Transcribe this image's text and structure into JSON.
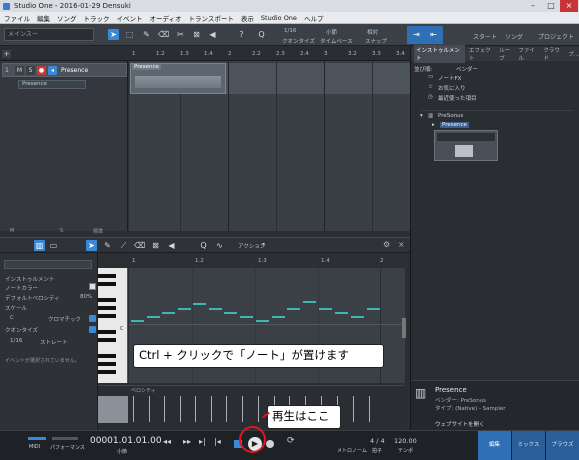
{
  "window": {
    "title": "Studio One - 2016-01-29 Densuki"
  },
  "menu": [
    "ファイル",
    "編集",
    "ソング",
    "トラック",
    "イベント",
    "オーディオ",
    "トランスポート",
    "表示",
    "Studio One",
    "ヘルプ"
  ],
  "toolbar": {
    "song_sel": "メインスー",
    "quantize_value": "1/16",
    "quantize_label": "クオンタイズ",
    "timebase_label": "タイムベース",
    "timebase_value": "小節",
    "snap_label": "スナップ",
    "snap_value": "相対",
    "start_label": "スタート",
    "song_label": "ソング",
    "project_label": "プロジェクト"
  },
  "ruler": {
    "ticks": [
      "1",
      "1.2",
      "1.3",
      "1.4",
      "2",
      "2.2",
      "2.3",
      "2.4",
      "3",
      "3.2",
      "3.3",
      "3.4"
    ]
  },
  "track": {
    "number": "1",
    "name": "Presence",
    "sub_name": "Presence",
    "m": "M",
    "s": "S",
    "r": "●",
    "clip_name": "Presence"
  },
  "browser": {
    "tabs": [
      "インストゥルメント",
      "エフェクト",
      "ループ",
      "ファイル",
      "クラウド",
      "プ..."
    ],
    "sort_label": "並び順:",
    "sort_value": "ベンダー",
    "items": [
      "ノートFX",
      "お気に入り",
      "最近使った項目"
    ],
    "vendor": "PreSonus",
    "instrument": "Presence"
  },
  "instrument_panel": {
    "name": "Presence",
    "vendor": "ベンダー: PreSonus",
    "type": "タイプ: (Native) - Sampler",
    "web_link": "ウェブサイトを開く"
  },
  "editor": {
    "mode_label": "アクション",
    "inspector_title": "インストゥルメント",
    "note_color_label": "ノートカラー",
    "velocity_label": "デフォルトベロシティ",
    "velocity_value": "80%",
    "scale_label": "スケール",
    "scale_value": "クロマチック",
    "root": "C",
    "quantize_label": "クオンタイズ",
    "q_value": "1/16",
    "q_mode": "ストレート",
    "empty_msg": "イベントが選択されていません。",
    "velocity_lane": "ベロシティ",
    "ruler_ticks": [
      "1",
      "1.2",
      "1.3",
      "1.4",
      "2"
    ],
    "mini_labels": [
      "M",
      "S",
      "標準"
    ]
  },
  "transport": {
    "time_value": "00001.01.01.00",
    "time_unit": "小節",
    "perf_label": "パフォーマンス",
    "midi_label": "MIDI",
    "meter_value": "4 / 4",
    "meter_label": "拍子",
    "tempo_value": "120.00",
    "tempo_label": "テンポ",
    "metronome_label": "メトロノーム",
    "edit_tab": "編集",
    "mix_tab": "ミックス",
    "browse_tab": "ブラウズ"
  },
  "annotations": {
    "ctrl_click": "Ctrl + クリックで「ノート」が置けます",
    "play_here": "再生はここ"
  }
}
